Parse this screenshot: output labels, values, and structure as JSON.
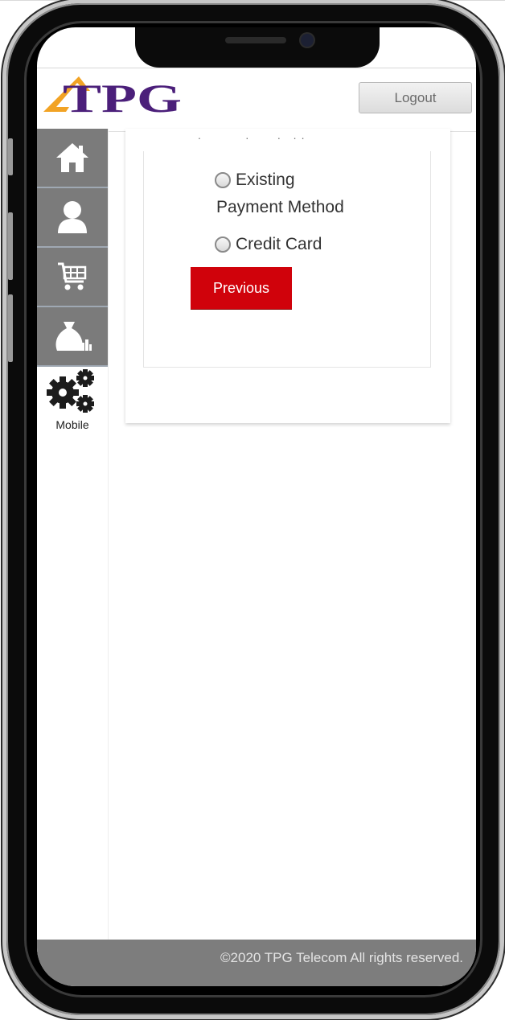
{
  "header": {
    "logo_text": "TPG",
    "logout_label": "Logout"
  },
  "nav": {
    "items": [
      {
        "icon": "home-icon"
      },
      {
        "icon": "user-icon"
      },
      {
        "icon": "cart-icon"
      },
      {
        "icon": "money-bag-icon"
      },
      {
        "icon": "gears-icon",
        "label": "Mobile"
      }
    ]
  },
  "payment": {
    "options": [
      {
        "label_line1": "Existing",
        "label_line2": "Payment Method"
      },
      {
        "label_line1": "Credit Card"
      }
    ],
    "previous_label": "Previous"
  },
  "footer": {
    "copyright": "©2020 TPG Telecom All rights reserved."
  },
  "colors": {
    "brand_purple": "#4b1f7a",
    "brand_orange": "#f2a324",
    "button_red": "#d0020b",
    "nav_gray": "#7b7b7b"
  }
}
